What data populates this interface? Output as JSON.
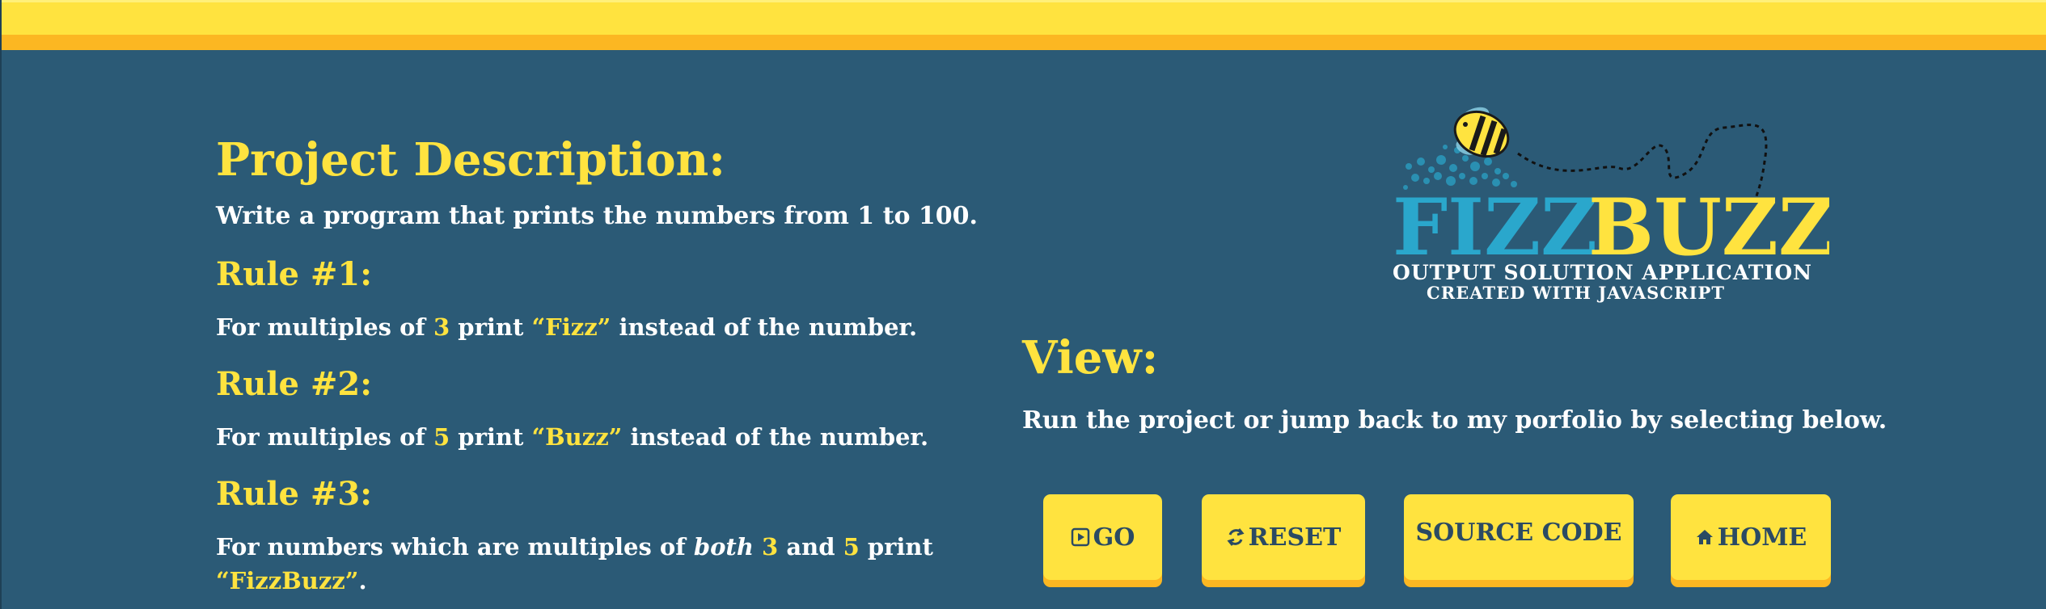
{
  "project": {
    "title": "Project Description:",
    "description": "Write a program that prints the numbers from 1 to 100."
  },
  "rules": [
    {
      "title": "Rule #1:",
      "text_before": "For multiples of ",
      "number": "3",
      "text_mid": " print ",
      "word": "“Fizz”",
      "text_after": " instead of the number."
    },
    {
      "title": "Rule #2:",
      "text_before": "For multiples of ",
      "number": "5",
      "text_mid": " print ",
      "word": "“Buzz”",
      "text_after": " instead of the number."
    },
    {
      "title": "Rule #3:",
      "text_before": "For numbers which are multiples of ",
      "emphasis": "both",
      "number_a": "3",
      "and_text": " and ",
      "number_b": "5",
      "text_mid": " print ",
      "word": "“FizzBuzz”",
      "text_after": "."
    }
  ],
  "logo": {
    "word_fizz": "FIZZ",
    "word_buzz": "BUZZ",
    "subtitle": "OUTPUT SOLUTION APPLICATION",
    "tagline": "CREATED WITH JAVASCRIPT"
  },
  "view": {
    "title": "View:",
    "text": "Run the project or jump back to my porfolio by selecting below."
  },
  "buttons": {
    "go_label": "GO",
    "reset_label": "RESET",
    "source_label": "SOURCE CODE",
    "home_label": "HOME"
  },
  "icons": {
    "go": "play-square-icon",
    "reset": "refresh-icon",
    "home": "home-icon",
    "bee": "bee-icon"
  },
  "colors": {
    "background": "#2b5a76",
    "accent_yellow": "#ffe33f",
    "accent_orange": "#fcb722",
    "fizz_blue": "#2aa7cc",
    "button_text": "#2b4a63"
  }
}
